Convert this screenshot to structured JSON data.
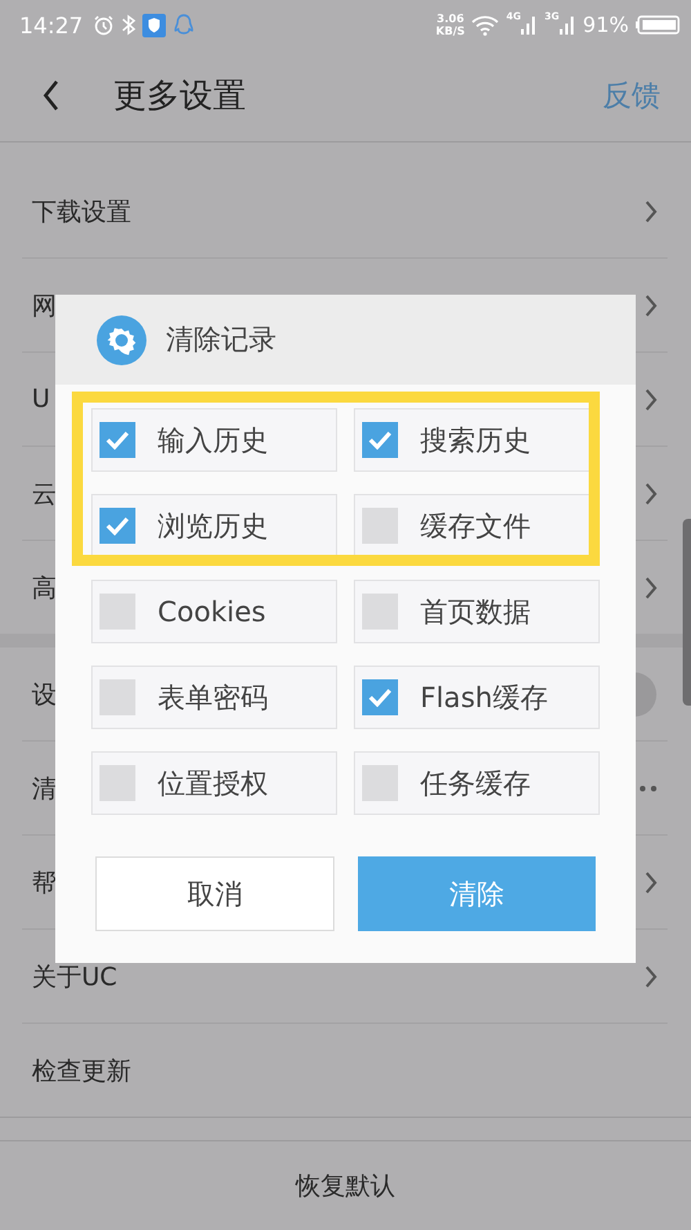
{
  "status_bar": {
    "time": "14:27",
    "speed": "3.06",
    "speed_unit": "KB/S",
    "network_1": "4G",
    "network_2": "3G",
    "battery": "91%"
  },
  "header": {
    "title": "更多设置",
    "action": "反馈"
  },
  "groups": [
    {
      "rows": [
        {
          "label": "下载设置",
          "kind": "chevron"
        },
        {
          "label": "网",
          "kind": "chevron"
        },
        {
          "label": "U",
          "kind": "chevron"
        },
        {
          "label": "云",
          "kind": "chevron"
        },
        {
          "label": "高",
          "kind": "chevron"
        }
      ]
    },
    {
      "rows": [
        {
          "label": "设",
          "kind": "toggle"
        },
        {
          "label": "清",
          "kind": "more"
        },
        {
          "label": "帮",
          "kind": "chevron"
        },
        {
          "label": "关于UC",
          "kind": "chevron"
        },
        {
          "label": "检查更新",
          "kind": "plain"
        }
      ]
    }
  ],
  "bottom_button": "恢复默认",
  "dialog": {
    "title": "清除记录",
    "options": [
      {
        "label": "输入历史",
        "checked": true
      },
      {
        "label": "搜索历史",
        "checked": true
      },
      {
        "label": "浏览历史",
        "checked": true
      },
      {
        "label": "缓存文件",
        "checked": false
      },
      {
        "label": "Cookies",
        "checked": false
      },
      {
        "label": "首页数据",
        "checked": false
      },
      {
        "label": "表单密码",
        "checked": false
      },
      {
        "label": "Flash缓存",
        "checked": true
      },
      {
        "label": "位置授权",
        "checked": false
      },
      {
        "label": "任务缓存",
        "checked": false
      }
    ],
    "cancel": "取消",
    "confirm": "清除"
  }
}
